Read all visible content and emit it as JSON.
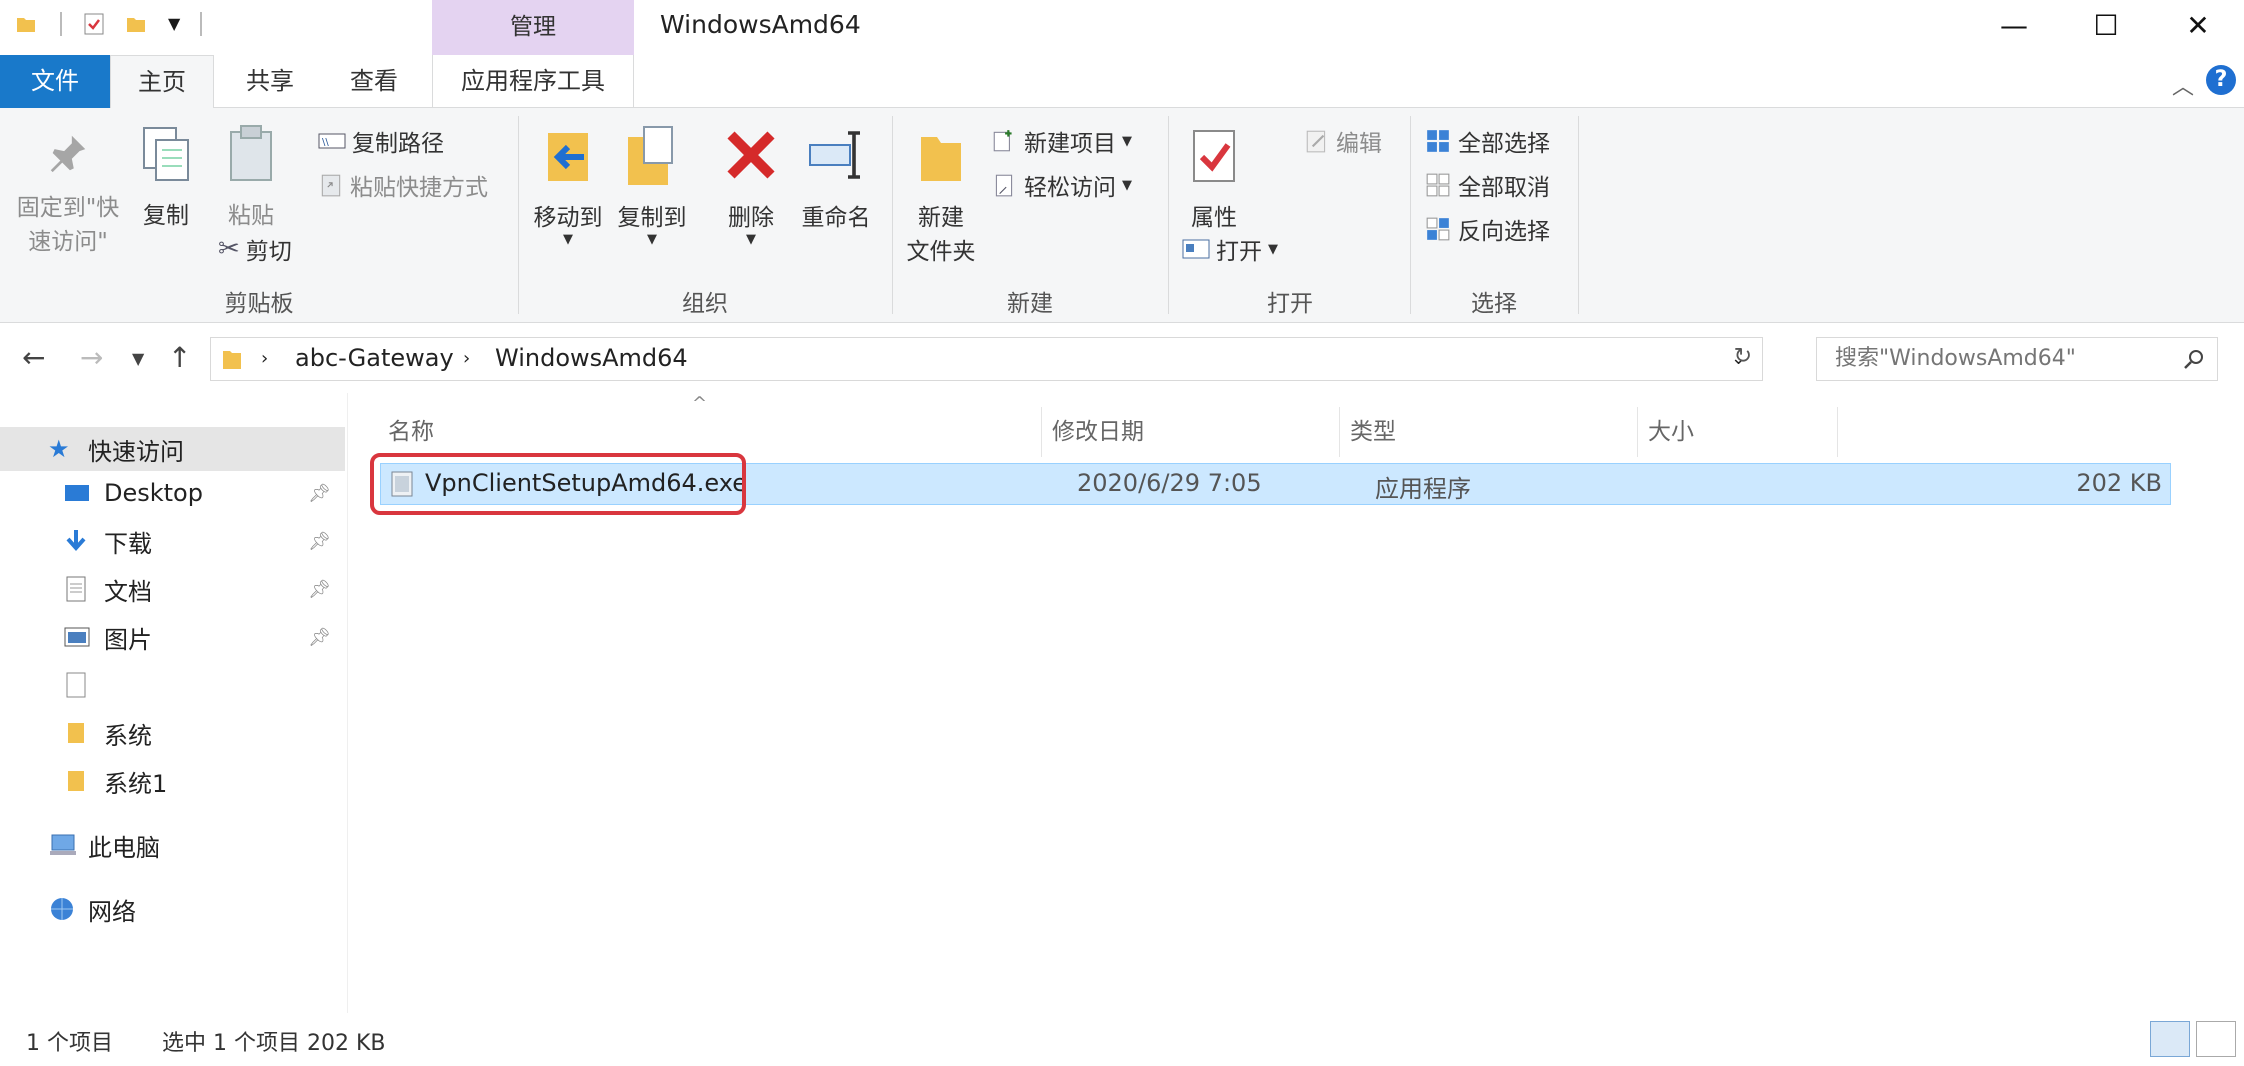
{
  "titlebar": {
    "manage_tab": "管理",
    "window_title": "WindowsAmd64",
    "minimize": "—",
    "maximize": "☐",
    "close": "✕"
  },
  "ribbon_tabs": {
    "file": "文件",
    "home": "主页",
    "share": "共享",
    "view": "查看",
    "app_tools": "应用程序工具"
  },
  "ribbon": {
    "pin_quick_access_1": "固定到\"快",
    "pin_quick_access_2": "速访问\"",
    "copy": "复制",
    "paste": "粘贴",
    "copy_path": "复制路径",
    "paste_shortcut": "粘贴快捷方式",
    "cut": "剪切",
    "clipboard_group": "剪贴板",
    "move_to": "移动到",
    "copy_to": "复制到",
    "delete": "删除",
    "rename": "重命名",
    "organize_group": "组织",
    "new_folder_1": "新建",
    "new_folder_2": "文件夹",
    "new_item": "新建项目",
    "easy_access": "轻松访问",
    "new_group": "新建",
    "properties": "属性",
    "open": "打开",
    "edit": "编辑",
    "open_group": "打开",
    "select_all": "全部选择",
    "select_none": "全部取消",
    "invert_selection": "反向选择",
    "select_group": "选择"
  },
  "address": {
    "crumbs": [
      "abc-Gateway",
      "WindowsAmd64"
    ],
    "search_placeholder": "搜索\"WindowsAmd64\""
  },
  "nav": {
    "quick_access": "快速访问",
    "items": [
      {
        "label": "Desktop",
        "icon": "desktop-icon",
        "pinned": true
      },
      {
        "label": "下载",
        "icon": "download-icon",
        "pinned": true
      },
      {
        "label": "文档",
        "icon": "document-icon",
        "pinned": true
      },
      {
        "label": "图片",
        "icon": "picture-icon",
        "pinned": true
      },
      {
        "label": "",
        "icon": "blank-file-icon",
        "pinned": false
      },
      {
        "label": "系统",
        "icon": "folder-icon",
        "pinned": false
      },
      {
        "label": "系统1",
        "icon": "folder-icon",
        "pinned": false
      }
    ],
    "this_pc": "此电脑",
    "network": "网络"
  },
  "columns": {
    "name": "名称",
    "modified": "修改日期",
    "type": "类型",
    "size": "大小"
  },
  "files": [
    {
      "name": "VpnClientSetupAmd64.exe",
      "modified": "2020/6/29 7:05",
      "type": "应用程序",
      "size": "202 KB"
    }
  ],
  "status": {
    "count": "1 个项目",
    "selected": "选中 1 个项目  202 KB"
  },
  "colors": {
    "file_tab": "#1979ca",
    "manage_tab": "#e4d3f1",
    "selection": "#cce8ff",
    "highlight": "#d9363e"
  }
}
